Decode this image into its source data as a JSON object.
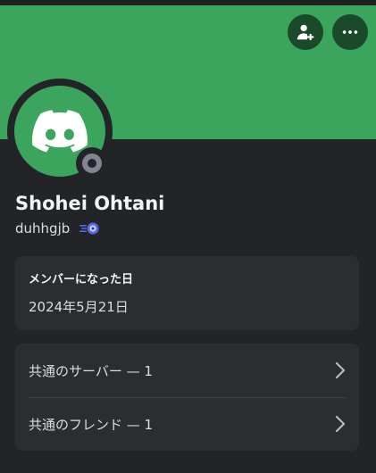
{
  "profile": {
    "display_name": "Shohei Ohtani",
    "username": "duhhgjb",
    "status": "offline",
    "banner_color": "#3ba55d",
    "avatar_icon": "discord-logo-icon"
  },
  "actions": {
    "add_friend_icon": "add-friend-icon",
    "more_icon": "more-options-icon"
  },
  "member_since": {
    "title": "メンバーになった日",
    "date": "2024年5月21日"
  },
  "mutual": {
    "servers_label": "共通のサーバー — 1",
    "friends_label": "共通のフレンド — 1",
    "chevron_icon": "chevron-right-icon"
  }
}
